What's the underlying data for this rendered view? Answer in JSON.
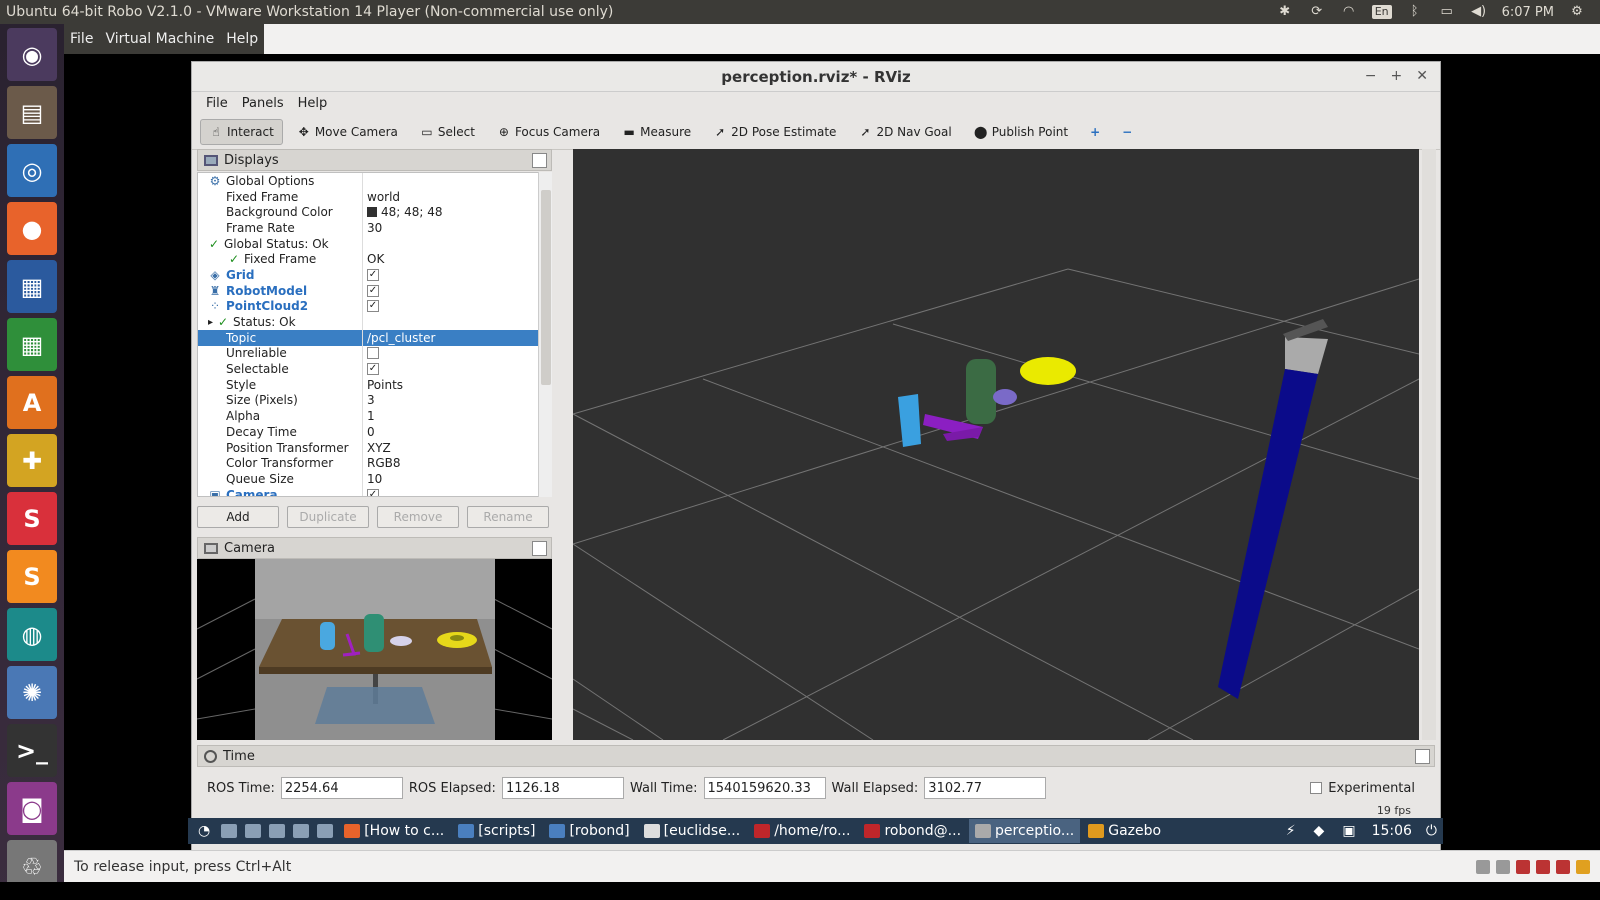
{
  "host": {
    "window_title": "Ubuntu 64-bit Robo V2.1.0 - VMware Workstation 14 Player (Non-commercial use only)",
    "tray": {
      "lang": "En",
      "clock": "6:07 PM"
    },
    "vm_menu": [
      "File",
      "Virtual Machine",
      "Help"
    ],
    "status_text": "To release input, press Ctrl+Alt"
  },
  "launcher": [
    {
      "name": "ubuntu-dash-icon",
      "glyph": "◉",
      "color": "#4b3a5e"
    },
    {
      "name": "files-icon",
      "glyph": "▤",
      "color": "#6b5a4a"
    },
    {
      "name": "chromium-icon",
      "glyph": "◎",
      "color": "#2f6fb5"
    },
    {
      "name": "firefox-icon",
      "glyph": "●",
      "color": "#e8632b"
    },
    {
      "name": "writer-icon",
      "glyph": "▦",
      "color": "#2b5a9e"
    },
    {
      "name": "calc-icon",
      "glyph": "▦",
      "color": "#2f8f3a"
    },
    {
      "name": "software-center-icon",
      "glyph": "A",
      "color": "#e0701e"
    },
    {
      "name": "vm-tools-icon",
      "glyph": "✚",
      "color": "#d3a422"
    },
    {
      "name": "slack-icon",
      "glyph": "S",
      "color": "#d9303b"
    },
    {
      "name": "sublime-icon",
      "glyph": "S",
      "color": "#f28a1f"
    },
    {
      "name": "gitkraken-icon",
      "glyph": "◍",
      "color": "#1c8a8a"
    },
    {
      "name": "app-swirl-icon",
      "glyph": "✺",
      "color": "#4a78b5"
    },
    {
      "name": "terminal-icon",
      "glyph": ">_",
      "color": "#333333"
    },
    {
      "name": "screen-recorder-icon",
      "glyph": "◙",
      "color": "#8b3a8b"
    },
    {
      "name": "trash-icon",
      "glyph": "♲",
      "color": "#777777"
    }
  ],
  "rviz": {
    "title": "perception.rviz* - RViz",
    "menu": [
      "File",
      "Panels",
      "Help"
    ],
    "tools": [
      {
        "label": "Interact",
        "glyph": "☝",
        "active": true
      },
      {
        "label": "Move Camera",
        "glyph": "✥"
      },
      {
        "label": "Select",
        "glyph": "▭"
      },
      {
        "label": "Focus Camera",
        "glyph": "⊕"
      },
      {
        "label": "Measure",
        "glyph": "▬"
      },
      {
        "label": "2D Pose Estimate",
        "glyph": "➚"
      },
      {
        "label": "2D Nav Goal",
        "glyph": "➚"
      },
      {
        "label": "Publish Point",
        "glyph": "⬤"
      }
    ],
    "displays_title": "Displays",
    "tree": [
      {
        "key": "Global Options",
        "value": "",
        "indent": 10,
        "icon": "⚙",
        "kind": "plain"
      },
      {
        "key": "Fixed Frame",
        "value": "world",
        "indent": 28,
        "kind": "plain"
      },
      {
        "key": "Background Color",
        "value": "48; 48; 48",
        "indent": 28,
        "kind": "color"
      },
      {
        "key": "Frame Rate",
        "value": "30",
        "indent": 28,
        "kind": "plain"
      },
      {
        "key": "Global Status: Ok",
        "value": "",
        "indent": 10,
        "icon": "✓",
        "kind": "ok"
      },
      {
        "key": "Fixed Frame",
        "value": "OK",
        "indent": 30,
        "icon": "✓",
        "kind": "ok"
      },
      {
        "key": "Grid",
        "value": "",
        "indent": 10,
        "icon": "◈",
        "kind": "blue",
        "checked": true
      },
      {
        "key": "RobotModel",
        "value": "",
        "indent": 10,
        "icon": "♜",
        "kind": "blue",
        "checked": true
      },
      {
        "key": "PointCloud2",
        "value": "",
        "indent": 10,
        "icon": "⁘",
        "kind": "blue",
        "checked": true
      },
      {
        "key": "Status: Ok",
        "value": "",
        "indent": 10,
        "icon": "✓",
        "kind": "status"
      },
      {
        "key": "Topic",
        "value": "/pcl_cluster",
        "indent": 28,
        "kind": "selected"
      },
      {
        "key": "Unreliable",
        "value": "",
        "indent": 28,
        "kind": "check",
        "checked": false
      },
      {
        "key": "Selectable",
        "value": "",
        "indent": 28,
        "kind": "check",
        "checked": true
      },
      {
        "key": "Style",
        "value": "Points",
        "indent": 28,
        "kind": "plain"
      },
      {
        "key": "Size (Pixels)",
        "value": "3",
        "indent": 28,
        "kind": "plain"
      },
      {
        "key": "Alpha",
        "value": "1",
        "indent": 28,
        "kind": "plain"
      },
      {
        "key": "Decay Time",
        "value": "0",
        "indent": 28,
        "kind": "plain"
      },
      {
        "key": "Position Transformer",
        "value": "XYZ",
        "indent": 28,
        "kind": "plain"
      },
      {
        "key": "Color Transformer",
        "value": "RGB8",
        "indent": 28,
        "kind": "plain"
      },
      {
        "key": "Queue Size",
        "value": "10",
        "indent": 28,
        "kind": "plain"
      },
      {
        "key": "Camera",
        "value": "",
        "indent": 10,
        "icon": "▣",
        "kind": "blue",
        "checked": true
      }
    ],
    "buttons": {
      "add": "Add",
      "duplicate": "Duplicate",
      "remove": "Remove",
      "rename": "Rename"
    },
    "camera_title": "Camera",
    "time": {
      "title": "Time",
      "ros_time_label": "ROS Time:",
      "ros_time": "2254.64",
      "ros_elapsed_label": "ROS Elapsed:",
      "ros_elapsed": "1126.18",
      "wall_time_label": "Wall Time:",
      "wall_time": "1540159620.33",
      "wall_elapsed_label": "Wall Elapsed:",
      "wall_elapsed": "3102.77",
      "experimental": "Experimental",
      "fps": "19 fps"
    }
  },
  "guest_panel": {
    "tasks": [
      {
        "label": "[How to c...",
        "color": "#e8632b"
      },
      {
        "label": "[scripts]",
        "color": "#4a7fbf"
      },
      {
        "label": "[robond]",
        "color": "#4a7fbf"
      },
      {
        "label": "[euclidse...",
        "color": "#dddddd"
      },
      {
        "label": "/home/ro...",
        "color": "#c0262a"
      },
      {
        "label": "robond@...",
        "color": "#c0262a"
      },
      {
        "label": "perceptio...",
        "color": "#aaaaaa",
        "active": true
      },
      {
        "label": "Gazebo",
        "color": "#e09a1e"
      }
    ],
    "clock": "15:06"
  }
}
